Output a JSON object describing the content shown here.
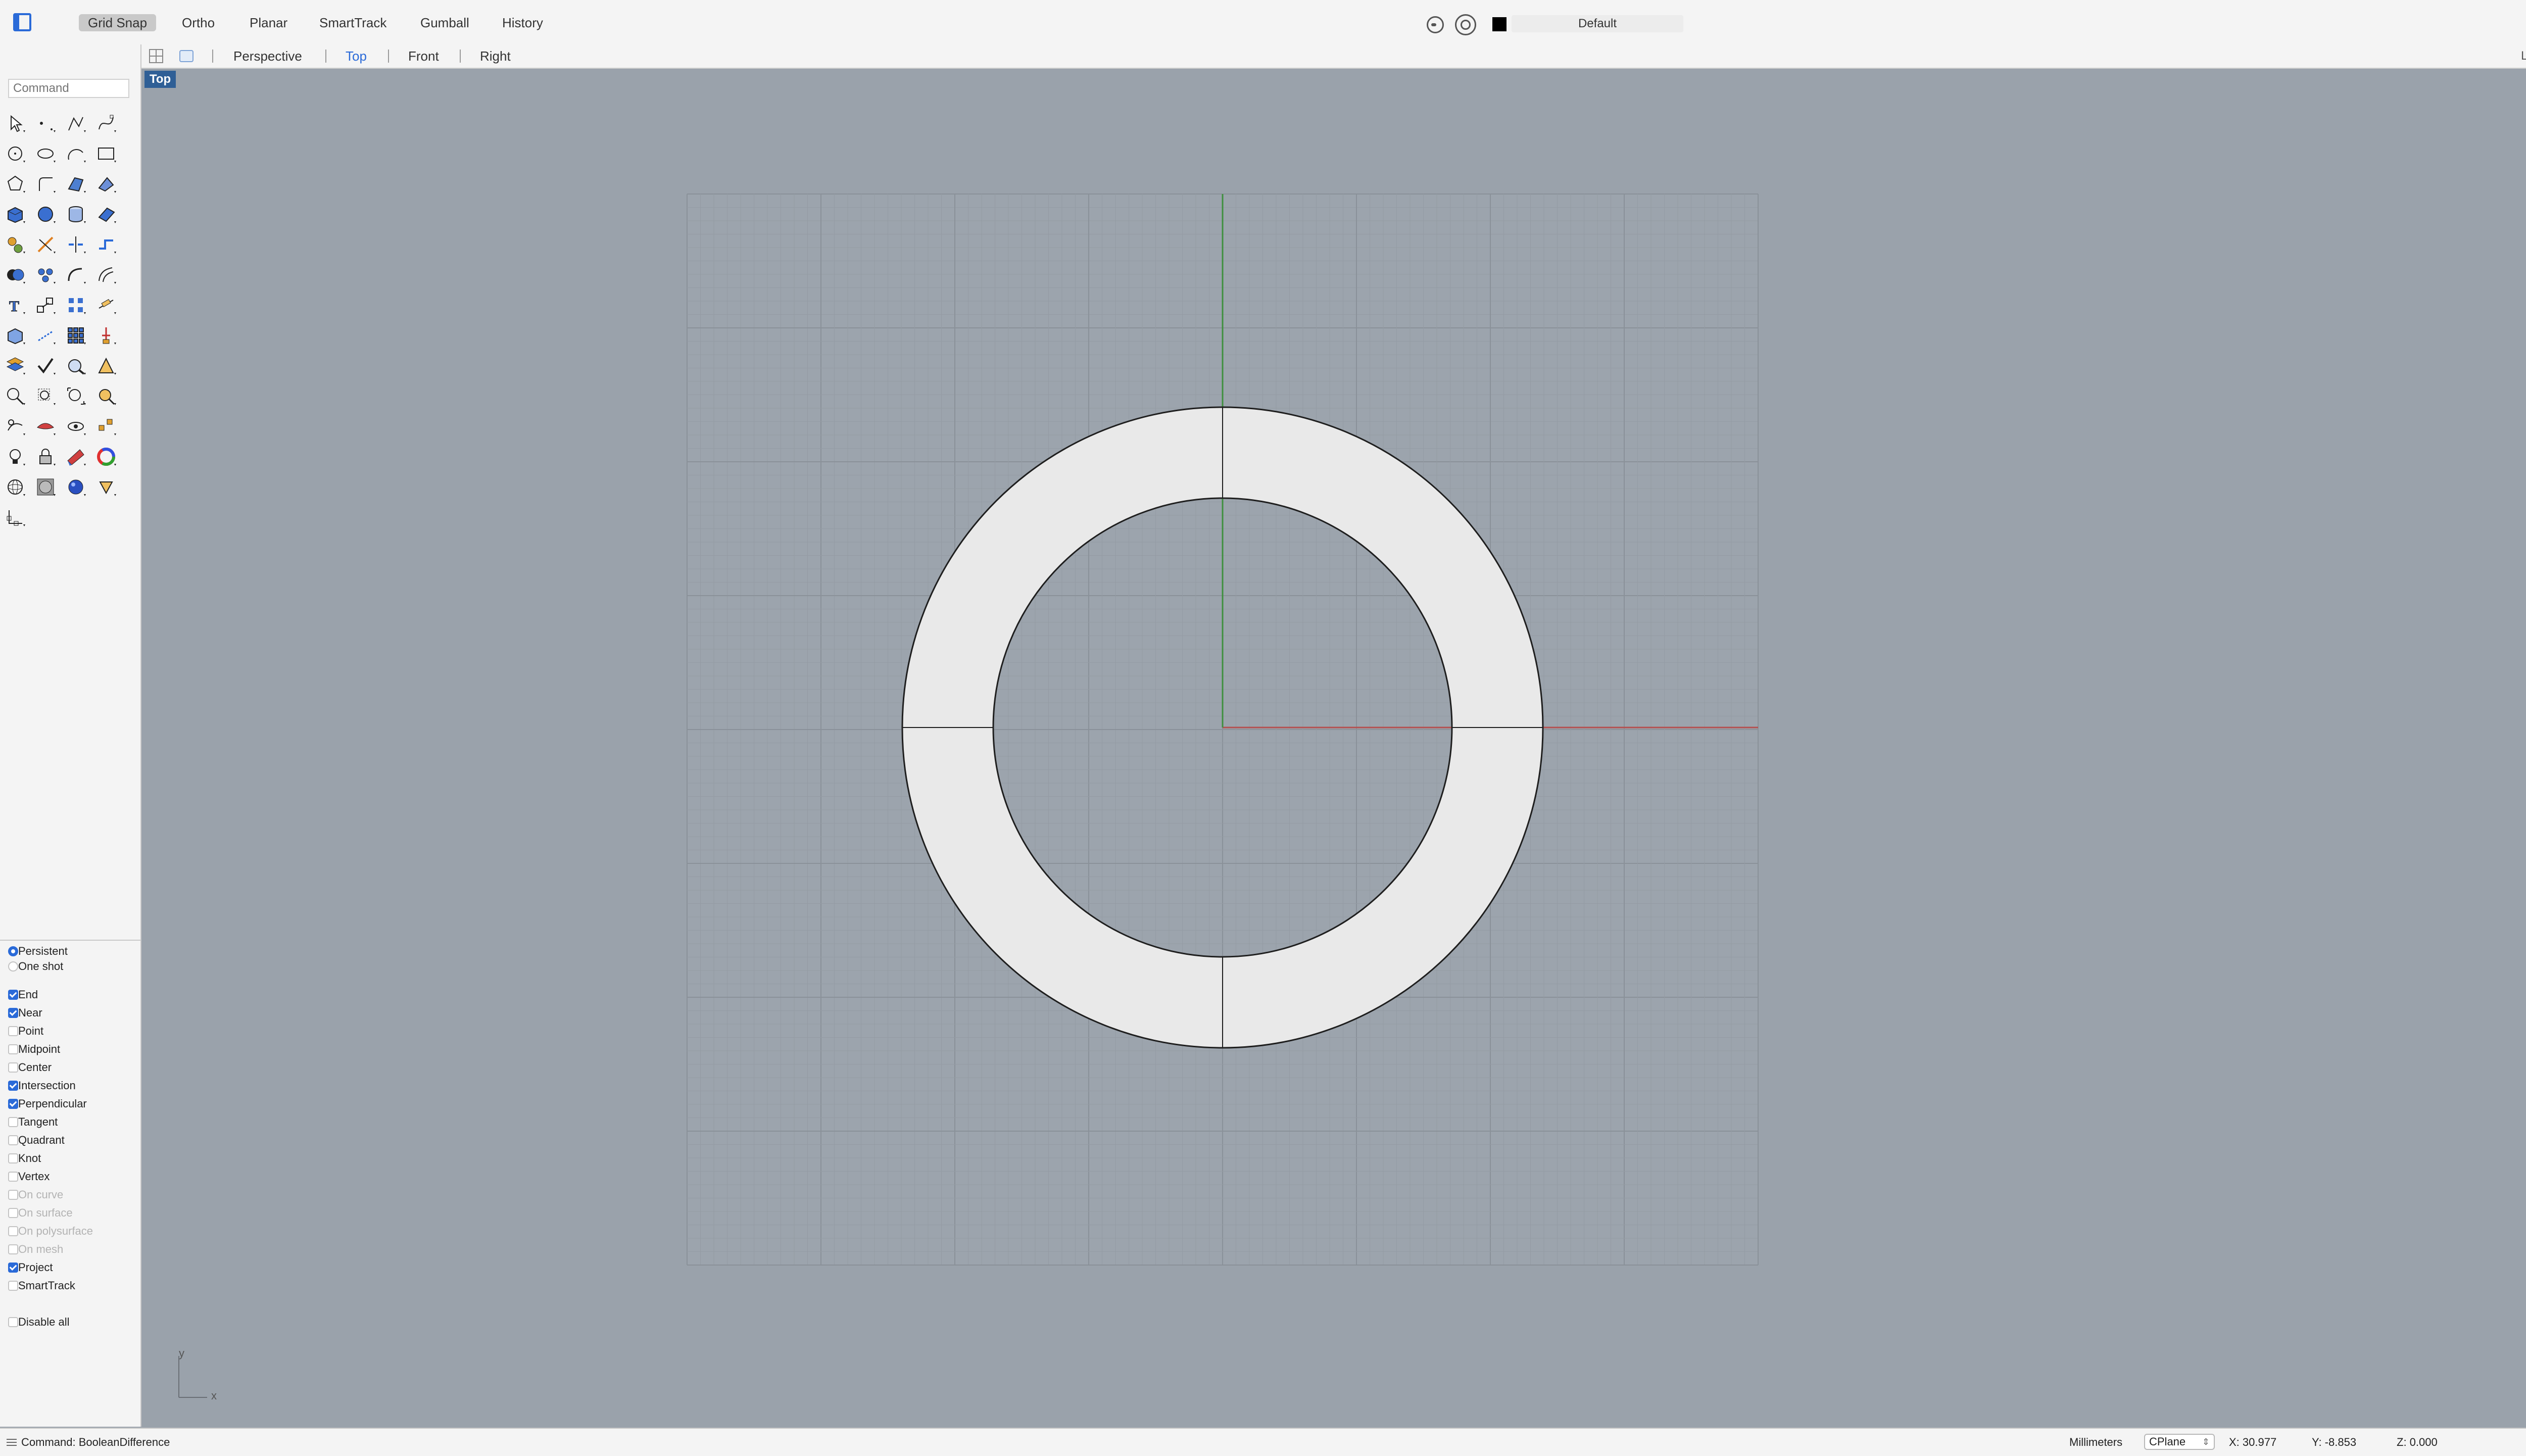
{
  "toolbar": {
    "buttons": [
      {
        "label": "Grid Snap",
        "active": true
      },
      {
        "label": "Ortho",
        "active": false
      },
      {
        "label": "Planar",
        "active": false
      },
      {
        "label": "SmartTrack",
        "active": false
      },
      {
        "label": "Gumball",
        "active": false
      },
      {
        "label": "History",
        "active": false
      }
    ],
    "layer_name": "Default",
    "layer_color": "#000000"
  },
  "viewport_tabs": {
    "tabs": [
      "Perspective",
      "Top",
      "Front",
      "Right"
    ],
    "active": "Top",
    "layouts_label": "Layouts..."
  },
  "command": {
    "placeholder": "Command"
  },
  "tools": [
    "select-arrow",
    "point",
    "polyline",
    "curve-control-points",
    "circle",
    "ellipse",
    "arc",
    "rectangle",
    "polygon",
    "fillet-curve",
    "surface-patch",
    "surface-edit",
    "box",
    "sphere",
    "cylinder",
    "solid-tools",
    "explode",
    "trim",
    "split",
    "join",
    "boolean",
    "group",
    "fillet",
    "curve-offset",
    "text",
    "transform",
    "array",
    "dimension",
    "mesh",
    "measure",
    "grid-array",
    "gumball",
    "layer",
    "check",
    "analyze",
    "render-tools",
    "zoom",
    "zoom-window",
    "zoom-extents",
    "zoom-selected",
    "pan",
    "display-mode",
    "visibility",
    "snapshot",
    "light",
    "lock",
    "material",
    "color-wheel",
    "wireframe-sphere",
    "shaded-sphere",
    "render-sphere",
    "cone-light",
    "cplane"
  ],
  "osnap": {
    "mode": [
      {
        "label": "Persistent",
        "selected": true
      },
      {
        "label": "One shot",
        "selected": false
      }
    ],
    "items": [
      {
        "label": "End",
        "checked": true,
        "enabled": true
      },
      {
        "label": "Near",
        "checked": true,
        "enabled": true
      },
      {
        "label": "Point",
        "checked": false,
        "enabled": true
      },
      {
        "label": "Midpoint",
        "checked": false,
        "enabled": true
      },
      {
        "label": "Center",
        "checked": false,
        "enabled": true
      },
      {
        "label": "Intersection",
        "checked": true,
        "enabled": true
      },
      {
        "label": "Perpendicular",
        "checked": true,
        "enabled": true
      },
      {
        "label": "Tangent",
        "checked": false,
        "enabled": true
      },
      {
        "label": "Quadrant",
        "checked": false,
        "enabled": true
      },
      {
        "label": "Knot",
        "checked": false,
        "enabled": true
      },
      {
        "label": "Vertex",
        "checked": false,
        "enabled": true
      },
      {
        "label": "On curve",
        "checked": false,
        "enabled": false
      },
      {
        "label": "On surface",
        "checked": false,
        "enabled": false
      },
      {
        "label": "On polysurface",
        "checked": false,
        "enabled": false
      },
      {
        "label": "On mesh",
        "checked": false,
        "enabled": false
      },
      {
        "label": "Project",
        "checked": true,
        "enabled": true
      },
      {
        "label": "SmartTrack",
        "checked": false,
        "enabled": true
      }
    ],
    "disable_all": "Disable all"
  },
  "viewport": {
    "label": "Top",
    "axis_y": "y",
    "axis_x": "x",
    "x_axis_color": "#b45050",
    "y_axis_color": "#3f8f3f"
  },
  "status": {
    "command_text": "Command: BooleanDifference",
    "units": "Millimeters",
    "cplane": "CPlane",
    "x": "X: 30.977",
    "y": "Y: -8.853",
    "z": "Z: 0.000"
  }
}
